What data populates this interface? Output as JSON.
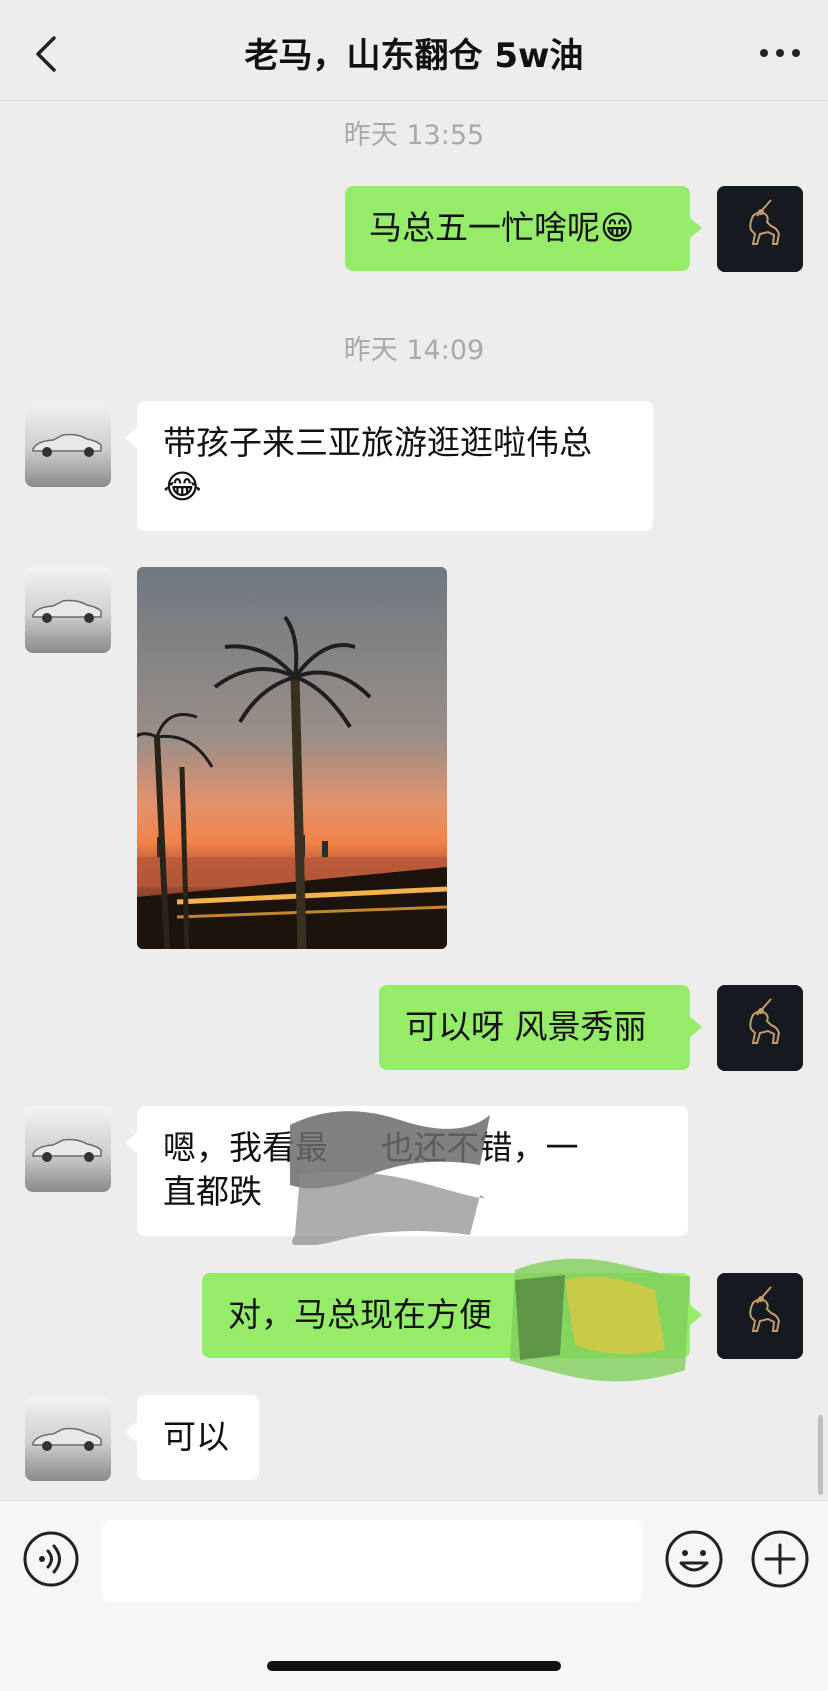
{
  "header": {
    "title": "老马，山东翻仓 5w油",
    "back_icon": "chevron-left-icon",
    "more_icon": "ellipsis-icon"
  },
  "messages": {
    "time1": "昨天 13:55",
    "m1": "马总五一忙啥呢😁",
    "time2": "昨天 14:09",
    "m2": "带孩子来三亚旅游逛逛啦伟总😂",
    "m4": "可以呀 风景秀丽",
    "m5_line1": "嗯，我看最     也还不错，一",
    "m5_line2": "直都跌",
    "m6": "对，马总现在方便",
    "m7": "可以"
  },
  "input": {
    "value": "",
    "placeholder": ""
  },
  "icons": {
    "voice": "voice-icon",
    "emoji": "emoji-icon",
    "plus": "plus-icon"
  },
  "colors": {
    "outgoing_bubble": "#95ec69",
    "incoming_bubble": "#ffffff",
    "background": "#ededed"
  }
}
